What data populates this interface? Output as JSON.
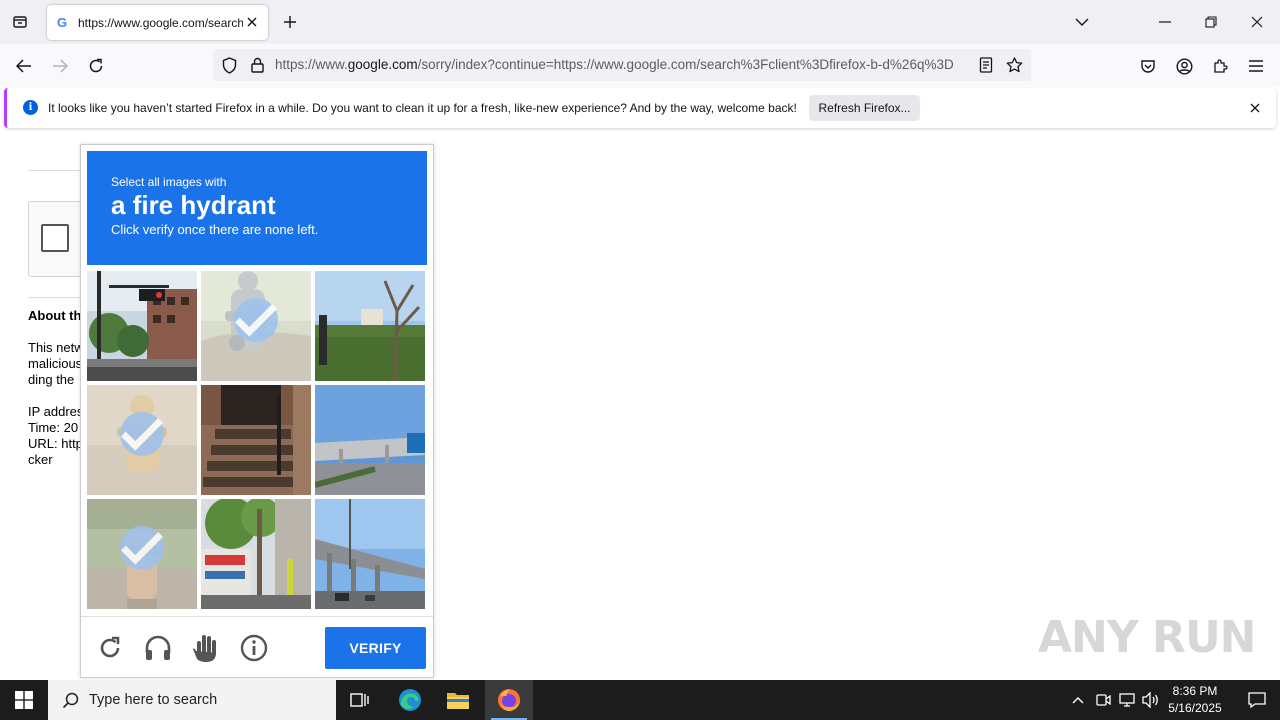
{
  "browser": {
    "tab": {
      "title": "https://www.google.com/search?client=firefox",
      "favicon": "G"
    },
    "url": {
      "prefix": "https://www.",
      "domain": "google.com",
      "rest": "/sorry/index?continue=https://www.google.com/search%3Fclient%3Dfirefox-b-d%26q%3D"
    }
  },
  "notification": {
    "message": "It looks like you haven’t started Firefox in a while. Do you want to clean it up for a fresh, like-new experience? And by the way, welcome back!",
    "button": "Refresh Firefox..."
  },
  "page": {
    "heading": "About th",
    "para1": [
      "This netw",
      "malicious",
      "ding the"
    ],
    "para2": [
      "IP addres",
      "Time: 20",
      "URL: http",
      "cker"
    ]
  },
  "captcha": {
    "instruction_sub": "Select all images with",
    "target": "a fire hydrant",
    "hint": "Click verify once there are none left.",
    "verify_label": "VERIFY",
    "tiles": [
      {
        "selected": false
      },
      {
        "selected": true
      },
      {
        "selected": false
      },
      {
        "selected": true
      },
      {
        "selected": false
      },
      {
        "selected": false
      },
      {
        "selected": true
      },
      {
        "selected": false
      },
      {
        "selected": false
      }
    ]
  },
  "taskbar": {
    "search_placeholder": "Type here to search",
    "time": "8:36 PM",
    "date": "5/16/2025"
  },
  "watermark": "ANY RUN",
  "colors": {
    "captcha_blue": "#1a73e8",
    "firefox_accent": "#b63fff"
  }
}
